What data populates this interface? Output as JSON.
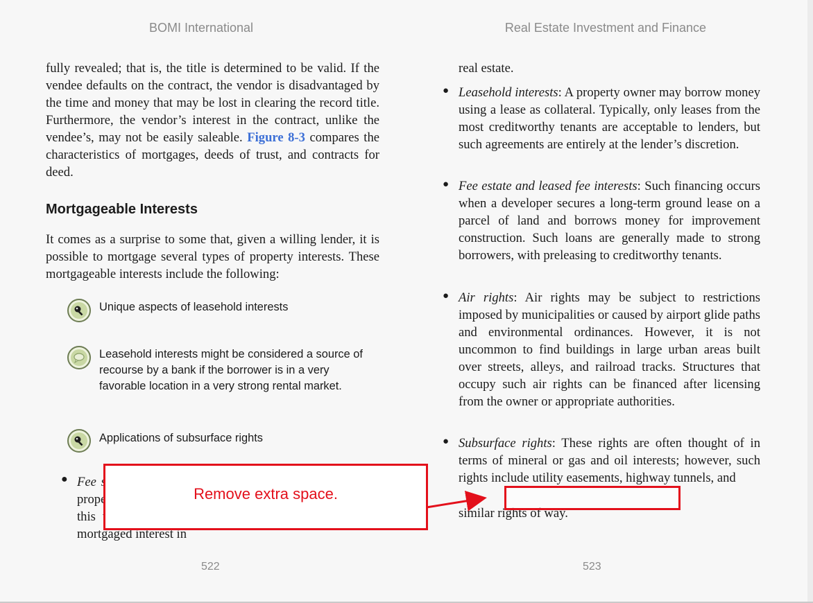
{
  "header": {
    "left_title": "BOMI International",
    "right_title": "Real Estate Investment and Finance"
  },
  "left_page": {
    "paragraph1_before_link": "fully revealed; that is, the title is determined to be valid. If the vendee defaults on the contract, the vendor is disadvantaged by the time and money that may be lost in clearing the record title. Furthermore, the vendor’s interest in the contract, unlike the vendee’s, may not be easily saleable. ",
    "paragraph1_link": "Figure 8-3",
    "paragraph1_after_link": " compares the characteristics of mortgages, deeds of trust, and contracts for deed.",
    "section_heading": "Mortgageable Interests",
    "paragraph2": "It comes as a surprise to some that, given a willing lender, it is possible to mortgage several types of property interests. These mortgageable interests include the following:",
    "notes": [
      {
        "icon": "magnifier-icon",
        "text": "Unique aspects of leasehold interests"
      },
      {
        "icon": "speech-bubble-icon",
        "text": "Leasehold interests might be considered a source of recourse by a bank if the borrower is in a very favorable location in a very strong rental market."
      },
      {
        "icon": "magnifier-icon",
        "text": "Applications of subsurface rights"
      }
    ],
    "bullet_term": "Fee simple interests",
    "bullet_text": ": A property owner may use his own property as collateral for a mortgage loan. Historically, this type of ownership interest is the most commonly mortgaged interest in",
    "page_number": "522"
  },
  "right_page": {
    "intro": "real estate.",
    "bullets": [
      {
        "term": "Leasehold interests",
        "text": ": A property owner may borrow money using a lease as collateral. Typically, only leases from the most creditworthy tenants are acceptable to lenders, but such agreements are entirely at the lender’s discretion."
      },
      {
        "term": "Fee estate and leased fee interests",
        "text": ": Such financing occurs when a developer secures a long-term ground lease on a parcel of land and borrows money for improvement construction. Such loans are generally made to strong borrowers, with preleasing to creditworthy tenants."
      },
      {
        "term": "Air rights",
        "text": ": Air rights may be subject to restrictions imposed by municipalities or caused by airport glide paths and environmental ordinances. However, it is not uncommon to find buildings in large urban areas built over streets, alleys, and railroad tracks. Structures that occupy such air rights can be financed after licensing from the owner or appropriate authorities."
      },
      {
        "term": "Subsurface rights",
        "text": ": These rights are often thought of in terms of mineral or gas and oil interests; however, such rights include utility easements, highway tunnels, and"
      }
    ],
    "last_line": "similar rights of way.",
    "page_number": "523"
  },
  "annotation": {
    "callout_text": "Remove extra space.",
    "color": "#e3101b"
  }
}
